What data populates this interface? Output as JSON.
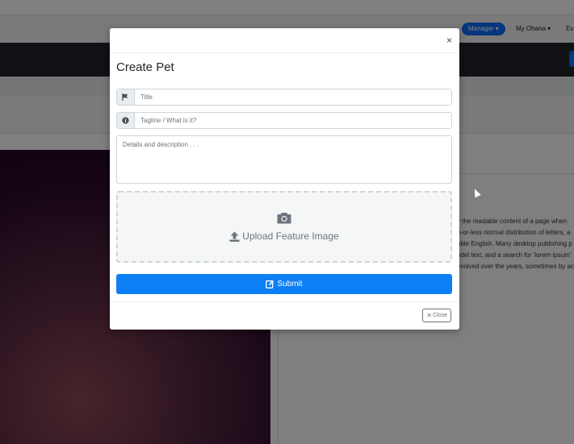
{
  "background": {
    "nav": {
      "manager_label": "Manager ▾",
      "my_ohana_label": "My Ohana ▾",
      "events_label": "Ev"
    },
    "content_lines": [
      "y the readable content of a page when",
      "e-or-less normal distribution of letters, a",
      "able English. Many desktop publishing p",
      "odel text, and a search for 'lorem ipsum'",
      "evolved over the years, sometimes by ac"
    ]
  },
  "modal": {
    "title": "Create Pet",
    "close_x": "×",
    "fields": {
      "title_placeholder": "Title",
      "tagline_placeholder": "Tagline / What is it?",
      "details_placeholder": "Details and description . . ."
    },
    "upload_label": "Upload Feature Image",
    "submit_label": "Submit",
    "close_label": "Close"
  },
  "colors": {
    "primary": "#0d7ff5",
    "manager_pill": "#0d6efd",
    "dark_bar": "#1f232a"
  },
  "icons": [
    "flag-icon",
    "info-circle-icon",
    "camera-icon",
    "upload-icon",
    "edit-icon",
    "times-icon"
  ]
}
